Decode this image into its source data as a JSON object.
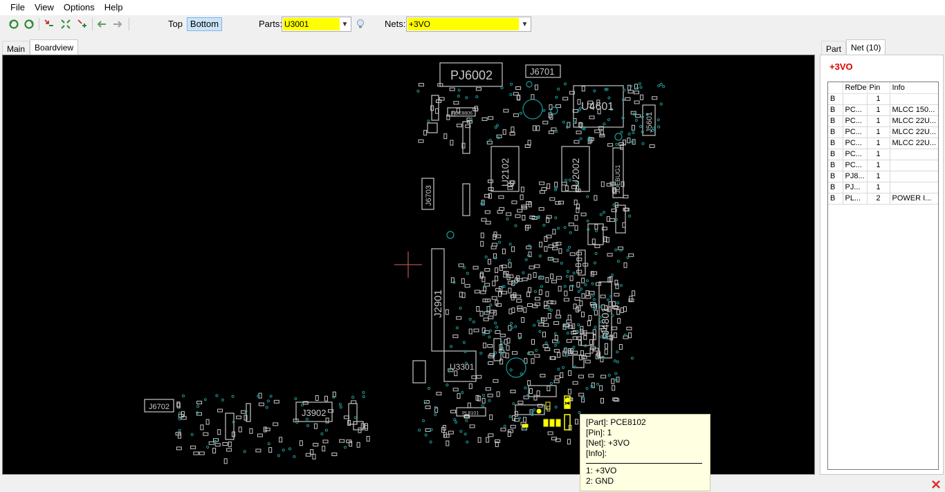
{
  "menu": [
    "File",
    "View",
    "Options",
    "Help"
  ],
  "toolbar": {
    "icons": [
      "rotate-left-icon",
      "rotate-right-icon",
      "zoom-out-icon",
      "fit-icon",
      "zoom-in-icon",
      "back-icon",
      "forward-icon"
    ],
    "layer_top": "Top",
    "layer_bottom": "Bottom",
    "parts_label": "Parts:",
    "parts_value": "U3001",
    "nets_label": "Nets:",
    "nets_value": "+3VO",
    "highlight_color": "#ffff00"
  },
  "left_tabs": [
    "Main",
    "Boardview"
  ],
  "right_tabs": [
    "Part",
    "Net (10)"
  ],
  "board": {
    "labels": [
      "PJ6002",
      "J6701",
      "U4601",
      "J5601",
      "U2102",
      "U2002",
      "J6703",
      "J2901",
      "J4801",
      "U3301",
      "J6702",
      "J3902",
      "PCE8806",
      "PCE8102",
      "PL8101",
      "PJ8102",
      "JDEBUG1"
    ],
    "cursor_color": "#b05050",
    "pad_color": "#c8c8c8",
    "via_color": "#1a9c9c",
    "highlight_color": "#ffff00"
  },
  "tooltip": {
    "part": "[Part]: PCE8102",
    "pin": "[Pin]: 1",
    "net": "[Net]: +3VO",
    "info": "[Info]:",
    "pin1": "1: +3VO",
    "pin2": "2: GND"
  },
  "net_panel": {
    "title": "+3VO",
    "columns": [
      "",
      "RefDe",
      "Pin",
      "Info"
    ],
    "rows": [
      [
        "B",
        "",
        "1",
        ""
      ],
      [
        "B",
        "PC...",
        "1",
        "MLCC 150..."
      ],
      [
        "B",
        "PC...",
        "1",
        "MLCC 22U..."
      ],
      [
        "B",
        "PC...",
        "1",
        "MLCC 22U..."
      ],
      [
        "B",
        "PC...",
        "1",
        "MLCC 22U..."
      ],
      [
        "B",
        "PC...",
        "1",
        ""
      ],
      [
        "B",
        "PC...",
        "1",
        ""
      ],
      [
        "B",
        "PJ8...",
        "1",
        ""
      ],
      [
        "B",
        "PJ...",
        "1",
        ""
      ],
      [
        "B",
        "PL...",
        "2",
        "POWER I..."
      ]
    ]
  },
  "status": {
    "close_icon": "close-icon",
    "close_color": "#e03030"
  }
}
